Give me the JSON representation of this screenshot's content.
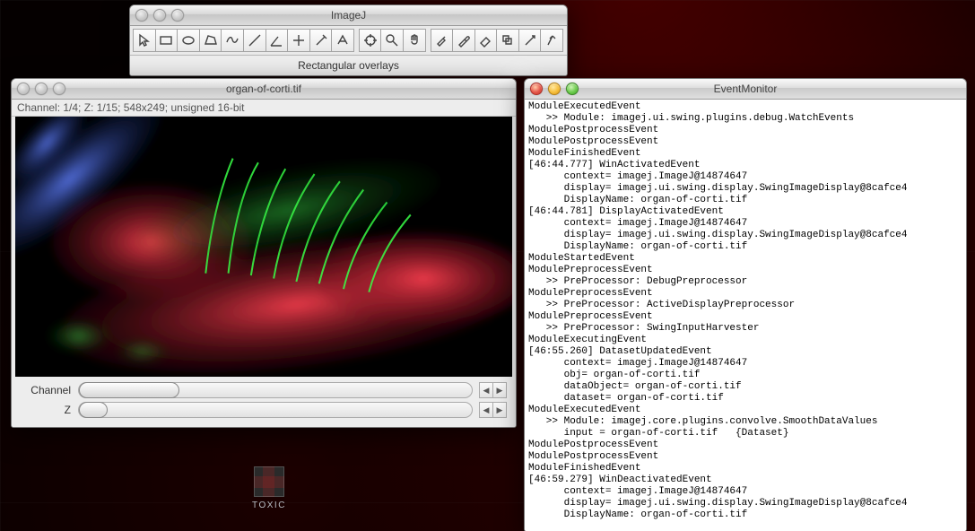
{
  "imagej": {
    "title": "ImageJ",
    "status": "Rectangular overlays",
    "tools": [
      "arrow-select",
      "rectangle",
      "oval",
      "polygon",
      "freehand",
      "line",
      "angle",
      "point",
      "wand",
      "text",
      "crosshair",
      "magnifier",
      "hand",
      "paint",
      "dropper",
      "eraser",
      "stack-next",
      "stack-prev",
      "dev"
    ]
  },
  "imageWin": {
    "title": "organ-of-corti.tif",
    "meta": "Channel: 1/4; Z: 1/15; 548x249; unsigned 16-bit",
    "slider_channel_label": "Channel",
    "slider_z_label": "Z"
  },
  "monitor": {
    "title": "EventMonitor",
    "log": [
      "ModuleExecutedEvent",
      "   >> Module: imagej.ui.swing.plugins.debug.WatchEvents",
      "ModulePostprocessEvent",
      "ModulePostprocessEvent",
      "ModuleFinishedEvent",
      "[46:44.777] WinActivatedEvent",
      "      context= imagej.ImageJ@14874647",
      "      display= imagej.ui.swing.display.SwingImageDisplay@8cafce4",
      "      DisplayName: organ-of-corti.tif",
      "[46:44.781] DisplayActivatedEvent",
      "      context= imagej.ImageJ@14874647",
      "      display= imagej.ui.swing.display.SwingImageDisplay@8cafce4",
      "      DisplayName: organ-of-corti.tif",
      "ModuleStartedEvent",
      "ModulePreprocessEvent",
      "   >> PreProcessor: DebugPreprocessor",
      "ModulePreprocessEvent",
      "   >> PreProcessor: ActiveDisplayPreprocessor",
      "ModulePreprocessEvent",
      "   >> PreProcessor: SwingInputHarvester",
      "ModuleExecutingEvent",
      "[46:55.260] DatasetUpdatedEvent",
      "      context= imagej.ImageJ@14874647",
      "      obj= organ-of-corti.tif",
      "      dataObject= organ-of-corti.tif",
      "      dataset= organ-of-corti.tif",
      "ModuleExecutedEvent",
      "   >> Module: imagej.core.plugins.convolve.SmoothDataValues",
      "      input = organ-of-corti.tif   {Dataset}",
      "ModulePostprocessEvent",
      "ModulePostprocessEvent",
      "ModuleFinishedEvent",
      "[46:59.279] WinDeactivatedEvent",
      "      context= imagej.ImageJ@14874647",
      "      display= imagej.ui.swing.display.SwingImageDisplay@8cafce4",
      "      DisplayName: organ-of-corti.tif"
    ]
  },
  "desktopIcon": {
    "label": "TOXIC"
  }
}
